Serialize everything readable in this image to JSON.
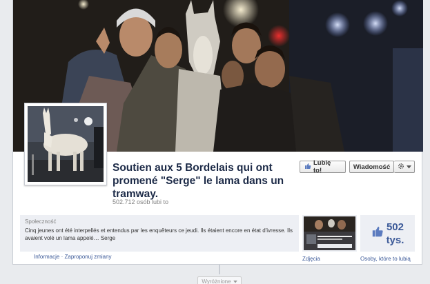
{
  "page": {
    "title": "Soutien aux 5 Bordelais qui ont promené \"Serge\" le lama dans un tramway.",
    "likes_text": "502.712 osób lubi to",
    "category": "Społeczność",
    "description": "Cinq jeunes ont été interpellés et entendus par les enquêteurs ce jeudi. Ils étaient encore en état d'ivresse. Ils avaient volé un lama appelé… Serge"
  },
  "actions": {
    "like_label": "Lubię to!",
    "message_label": "Wiadomość"
  },
  "links": {
    "info": "Informacje",
    "separator": "·",
    "suggest": "Zaproponuj zmiany",
    "photos": "Zdjęcia",
    "likers": "Osoby, które to lubią"
  },
  "likes_box": {
    "number": "502",
    "unit": "tys."
  },
  "timeline": {
    "highlights_label": "Wyróżnione"
  },
  "colors": {
    "link": "#3b5998",
    "title": "#1c2a47",
    "panel": "#edeff4"
  },
  "icons": [
    "thumbs-up-icon",
    "gear-icon",
    "chevron-down-icon"
  ]
}
